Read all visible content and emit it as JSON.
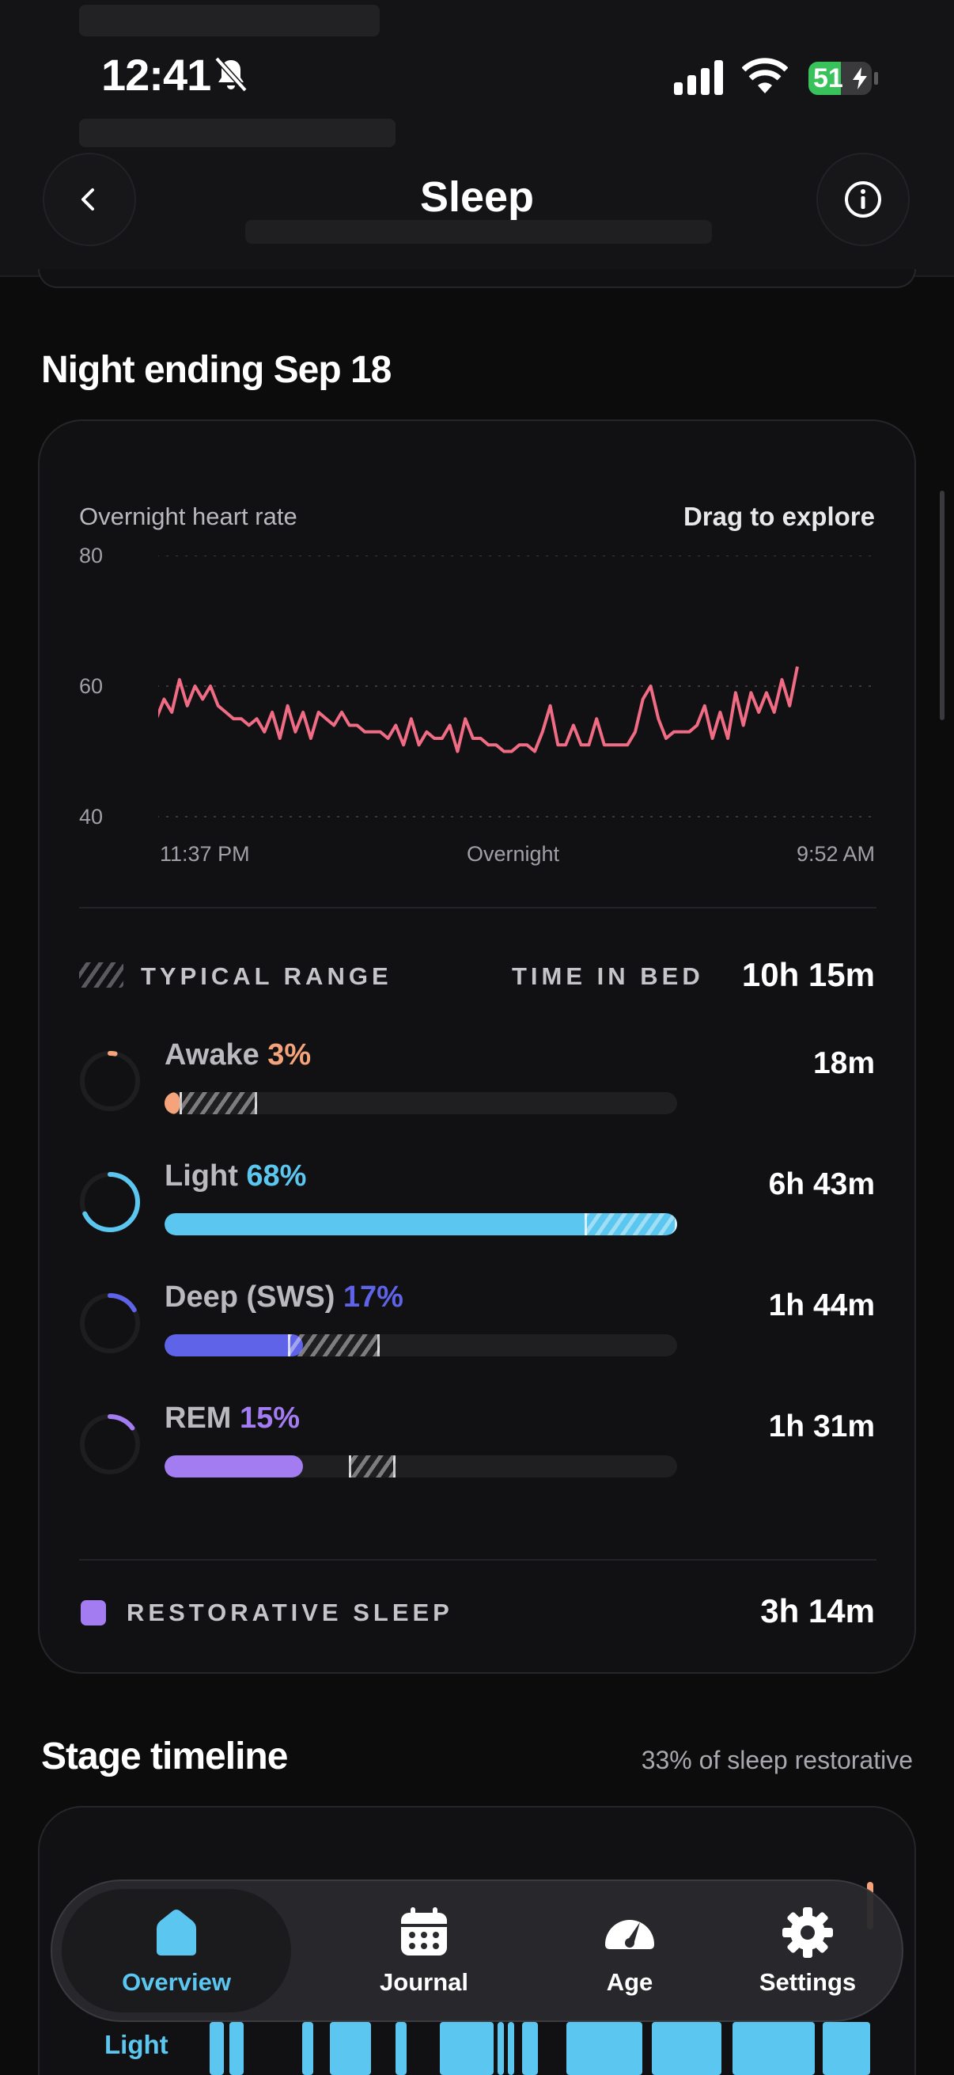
{
  "status_bar": {
    "time": "12:41",
    "battery": "51",
    "battery_level": 0.51
  },
  "header": {
    "title": "Sleep"
  },
  "night_section": {
    "title": "Night ending Sep 18"
  },
  "heart_chart": {
    "label": "Overnight heart rate",
    "hint": "Drag to explore",
    "y_ticks": [
      "80",
      "60",
      "40"
    ],
    "x_ticks": [
      "11:37 PM",
      "Overnight",
      "9:52 AM"
    ],
    "line_color": "#f06b84"
  },
  "chart_data": {
    "type": "line",
    "title": "Overnight heart rate",
    "xlabel": "",
    "ylabel": "",
    "ylim": [
      40,
      80
    ],
    "x_range": [
      "11:37 PM",
      "9:52 AM"
    ],
    "grid": true,
    "series": [
      {
        "values": [
          57,
          53,
          55,
          57,
          54,
          55,
          54,
          55,
          54,
          55,
          55,
          58,
          56,
          61,
          57,
          60,
          58,
          60,
          57,
          56,
          55,
          55,
          54,
          55,
          53,
          56,
          52,
          57,
          53,
          56,
          52,
          56,
          55,
          54,
          56,
          54,
          54,
          53,
          53,
          53,
          52,
          54,
          51,
          55,
          51,
          53,
          52,
          52,
          54,
          50,
          55,
          52,
          52,
          51,
          51,
          50,
          50,
          51,
          51,
          50,
          53,
          57,
          51,
          51,
          54,
          51,
          51,
          55,
          51,
          51,
          51,
          51,
          53,
          58,
          60,
          55,
          52,
          53,
          53,
          53,
          54,
          57,
          52,
          56,
          52,
          59,
          54,
          59,
          56,
          59,
          56,
          61,
          57,
          63
        ]
      }
    ]
  },
  "summary": {
    "typical_range_label": "TYPICAL RANGE",
    "time_in_bed_label": "TIME IN BED",
    "time_in_bed_value": "10h 15m"
  },
  "stages": [
    {
      "name": "Awake",
      "pct": "3%",
      "duration": "18m",
      "color": "#f4a37a",
      "fill": 0.03,
      "range": [
        0.03,
        0.18
      ]
    },
    {
      "name": "Light",
      "pct": "68%",
      "duration": "6h 43m",
      "color": "#5bc7f0",
      "fill": 1.0,
      "range": [
        0.82,
        1.0
      ]
    },
    {
      "name": "Deep (SWS)",
      "pct": "17%",
      "duration": "1h 44m",
      "color": "#5e63e8",
      "fill": 0.27,
      "range": [
        0.24,
        0.42
      ]
    },
    {
      "name": "REM",
      "pct": "15%",
      "duration": "1h 31m",
      "color": "#a27cf0",
      "fill": 0.27,
      "range": [
        0.36,
        0.45
      ]
    }
  ],
  "restorative": {
    "label": "RESTORATIVE SLEEP",
    "value": "3h 14m",
    "color": "#a27cf0"
  },
  "stage_timeline": {
    "title": "Stage timeline",
    "subtitle": "33% of sleep restorative",
    "row_label": "Light"
  },
  "tabs": [
    {
      "label": "Overview",
      "icon": "home-icon",
      "active": true
    },
    {
      "label": "Journal",
      "icon": "calendar-icon",
      "active": false
    },
    {
      "label": "Age",
      "icon": "gauge-icon",
      "active": false
    },
    {
      "label": "Settings",
      "icon": "gear-icon",
      "active": false
    }
  ]
}
